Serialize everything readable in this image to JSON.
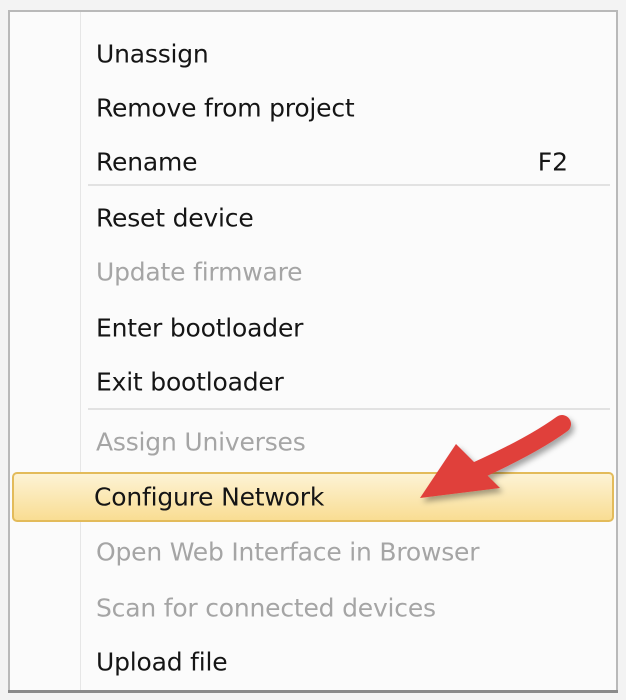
{
  "menu": {
    "items": [
      {
        "label": "Unassign",
        "enabled": true
      },
      {
        "label": "Remove from project",
        "enabled": true
      },
      {
        "label": "Rename",
        "shortcut": "F2",
        "enabled": true
      },
      {
        "label": "Reset device",
        "enabled": true
      },
      {
        "label": "Update firmware",
        "enabled": false
      },
      {
        "label": "Enter bootloader",
        "enabled": true
      },
      {
        "label": "Exit bootloader",
        "enabled": true
      },
      {
        "label": "Assign Universes",
        "enabled": false
      },
      {
        "label": "Configure Network",
        "enabled": true,
        "highlighted": true
      },
      {
        "label": "Open Web Interface in Browser",
        "enabled": false
      },
      {
        "label": "Scan for connected devices",
        "enabled": false
      },
      {
        "label": "Upload file",
        "enabled": true
      }
    ]
  },
  "colors": {
    "highlight_top": "#fdf3d5",
    "highlight_bottom": "#f9dd93",
    "highlight_border": "#e3bb5a",
    "annotation_arrow": "#e0403a",
    "disabled_text": "#a5a5a5"
  }
}
